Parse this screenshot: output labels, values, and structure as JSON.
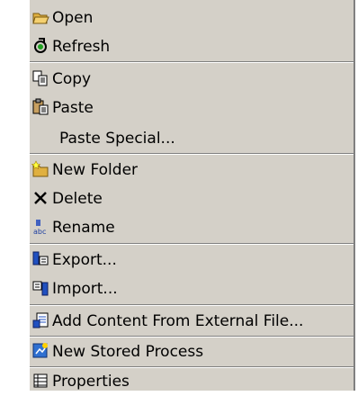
{
  "context_menu": {
    "items": [
      {
        "label": "Open",
        "icon": "folder-open-icon"
      },
      {
        "label": "Refresh",
        "icon": "refresh-icon"
      },
      {
        "label": "Copy",
        "icon": "copy-icon"
      },
      {
        "label": "Paste",
        "icon": "paste-icon"
      },
      {
        "label": "Paste Special...",
        "icon": ""
      },
      {
        "label": "New Folder",
        "icon": "new-folder-icon"
      },
      {
        "label": "Delete",
        "icon": "delete-icon"
      },
      {
        "label": "Rename",
        "icon": "rename-icon"
      },
      {
        "label": "Export...",
        "icon": "export-icon"
      },
      {
        "label": "Import...",
        "icon": "import-icon"
      },
      {
        "label": "Add Content From External File...",
        "icon": "add-content-icon"
      },
      {
        "label": "New Stored Process",
        "icon": "stored-process-icon"
      },
      {
        "label": "Properties",
        "icon": "properties-icon"
      }
    ]
  }
}
